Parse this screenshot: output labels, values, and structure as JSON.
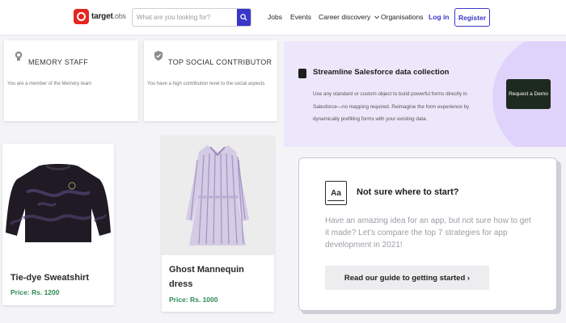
{
  "header": {
    "logo_text": "target",
    "logo_suffix": ".obs",
    "search_placeholder": "What are you looking for?",
    "nav": {
      "jobs": "Jobs",
      "events": "Events",
      "career": "Career discovery",
      "orgs": "Organisations"
    },
    "login": "Log in",
    "register": "Register"
  },
  "badges": [
    {
      "title": "MEMORY STAFF",
      "desc": "You are a member of the Memory team"
    },
    {
      "title": "TOP SOCIAL CONTRIBUTOR",
      "desc": "You have a high contribution level to the social aspects"
    }
  ],
  "ad": {
    "title": "Streamline Salesforce data collection",
    "body": "Use any standard or custom object to build powerful forms directly in Salesforce—no mapping required. Reimagine the form experience by dynamically prefilling forms with your existing data.",
    "cta": "Request a Demo"
  },
  "products": [
    {
      "name": "Tie-dye Sweatshirt",
      "price": "Price: Rs. 1200"
    },
    {
      "name": "Ghost Mannequin dress",
      "price": "Price: Rs. 1000"
    }
  ],
  "guide": {
    "icon_text": "Aa",
    "title": "Not sure where to start?",
    "body": "Have an amazing idea for an app, but not sure how to get it made? Let’s compare the top 7 strategies for app development in 2021!",
    "cta": "Read our guide to getting started ›"
  },
  "colors": {
    "brand": "#3b36c9",
    "logo_red": "#e3261f",
    "price_green": "#2d8a55",
    "ad_background": "#ece7fb"
  },
  "icons": {
    "search": "search-icon",
    "badge_memory": "memory-badge-icon",
    "badge_social": "shield-check-icon",
    "ad": "salesforce-icon",
    "guide": "font-icon"
  }
}
